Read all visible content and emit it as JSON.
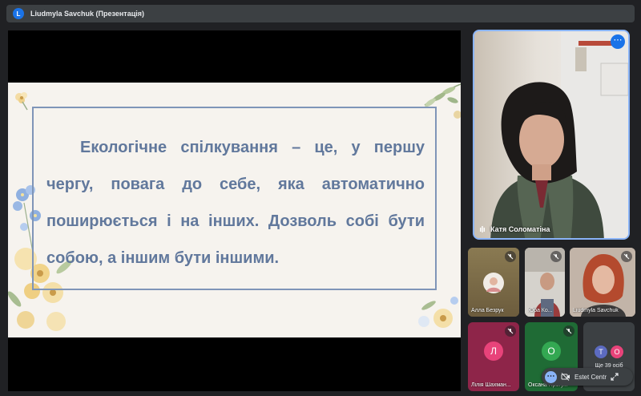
{
  "presentation_bar": {
    "avatar_letter": "L",
    "title": "Liudmyla Savchuk (Презентація)"
  },
  "slide": {
    "text": "Екологічне спілкування – це, у першу чергу, повага до себе, яка автоматично поширюється і на інших. Дозволь собі бути собою, а іншим бути іншими."
  },
  "speaker": {
    "name": "Катя Соломатіна",
    "more_options_icon": "more-vert-icon"
  },
  "participants": [
    {
      "name": "Алла Безрук",
      "muted": true
    },
    {
      "name": "Юра Ко...",
      "muted": true
    },
    {
      "name": "Liudmyla Savchuk",
      "muted": true
    },
    {
      "name": "Лілія Шахман...",
      "muted": true,
      "avatar_letter": "Л",
      "avatar_color": "#e8437a"
    },
    {
      "name": "Оксана Прогу...",
      "muted": true,
      "avatar_letter": "О",
      "avatar_color": "#33a852"
    }
  ],
  "more_participants": {
    "letters": [
      "Т",
      "О"
    ],
    "colors": [
      "#5c6bc0",
      "#e8437a"
    ],
    "label": "Ще 39 осіб"
  },
  "pip_bar": {
    "label": "Estet Centr"
  },
  "colors": {
    "accent": "#8ab4f8",
    "meet_dark": "#202124",
    "slide_text": "#61789c"
  }
}
